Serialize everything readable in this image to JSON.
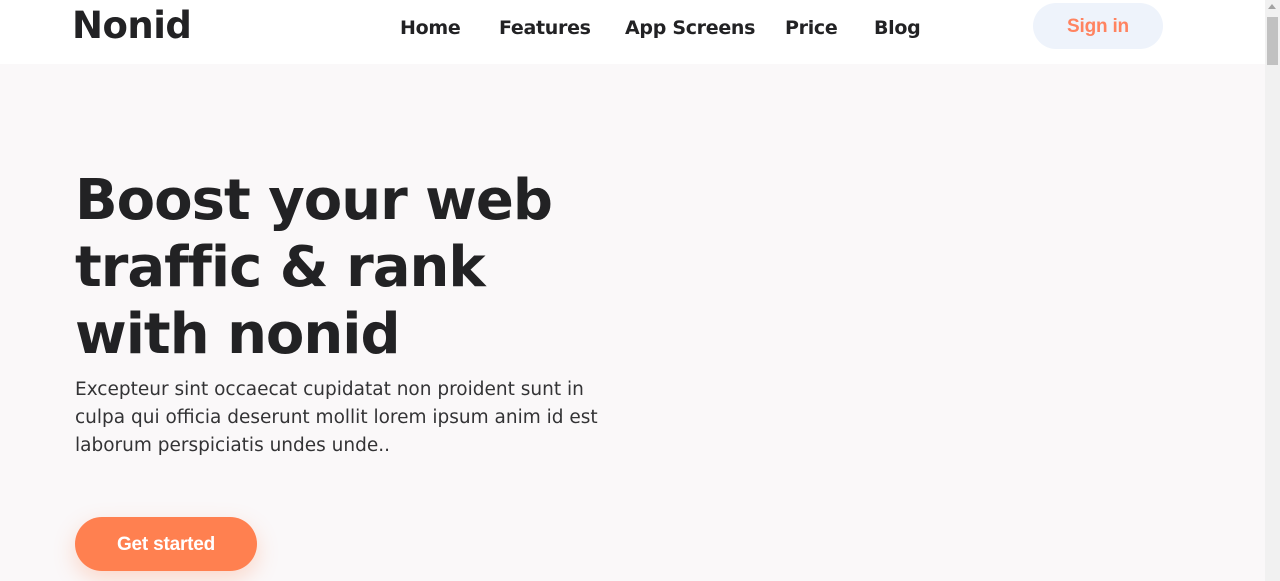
{
  "header": {
    "logo": "Nonid",
    "nav": [
      {
        "label": "Home"
      },
      {
        "label": "Features"
      },
      {
        "label": "App Screens"
      },
      {
        "label": "Price"
      },
      {
        "label": "Blog"
      }
    ],
    "sign_in_label": "Sign in"
  },
  "hero": {
    "title_lines": [
      "Boost your web",
      "traffic & rank",
      "with nonid"
    ],
    "text_lines": [
      "Excepteur sint occaecat cupidatat non proident sunt in",
      "culpa qui officia deserunt mollit lorem ipsum anim id est",
      "laborum perspiciatis undes unde.."
    ],
    "cta_label": "Get started"
  },
  "colors": {
    "accent": "#ff8050",
    "sign_in_bg": "#eef3fb",
    "text_dark": "#222224",
    "page_bg": "#faf8f9"
  }
}
